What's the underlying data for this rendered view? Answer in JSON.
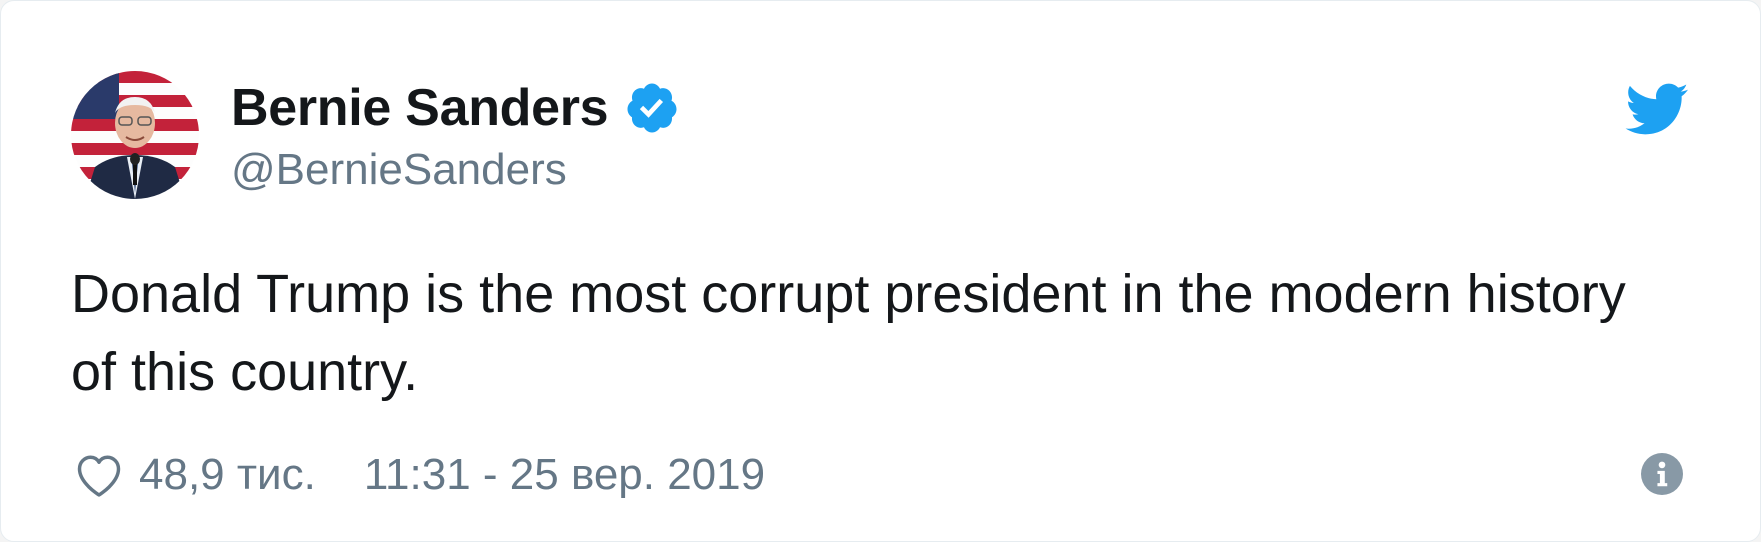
{
  "tweet": {
    "author": {
      "name": "Bernie Sanders",
      "handle": "@BernieSanders",
      "verified": true
    },
    "text": "Donald Trump is the most corrupt president in the modern history of this country.",
    "likes": "48,9 тис.",
    "timestamp": "11:31 - 25 вер. 2019"
  },
  "icons": {
    "verified": "verified-badge-icon",
    "brand": "twitter-bird-icon",
    "like": "heart-icon",
    "info": "info-icon"
  },
  "colors": {
    "twitter_blue": "#1da1f2",
    "text_primary": "#14171a",
    "text_secondary": "#657786",
    "info_icon": "#8899a6"
  }
}
